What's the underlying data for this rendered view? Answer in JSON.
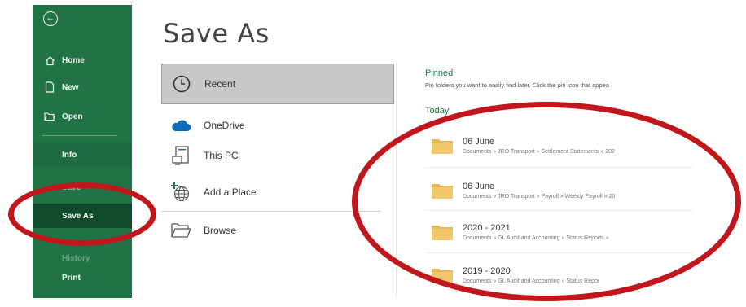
{
  "window": {
    "title": "Save As"
  },
  "sidebar": {
    "items": [
      {
        "label": "Home",
        "icon": "home-icon"
      },
      {
        "label": "New",
        "icon": "new-document-icon"
      },
      {
        "label": "Open",
        "icon": "open-folder-icon"
      },
      {
        "label": "Info"
      },
      {
        "label": "Save"
      },
      {
        "label": "Save As",
        "selected": true
      },
      {
        "label": "History"
      },
      {
        "label": "Print"
      }
    ]
  },
  "locations": [
    {
      "label": "Recent",
      "icon": "clock-icon",
      "selected": true
    },
    {
      "label": "OneDrive",
      "icon": "cloud-icon"
    },
    {
      "label": "This PC",
      "icon": "computer-icon"
    },
    {
      "label": "Add a Place",
      "icon": "globe-add-icon"
    },
    {
      "label": "Browse",
      "icon": "folder-open-icon"
    }
  ],
  "pinned": {
    "heading": "Pinned",
    "description": "Pin folders you want to easily find later. Click the pin icon that appea"
  },
  "today": {
    "heading": "Today",
    "folders": [
      {
        "name": "06 June",
        "path": "Documents » JRO Transport » Settlement Statements » 202"
      },
      {
        "name": "06 June",
        "path": "Documents » JRO Transport » Payroll » Weekly Payroll » 20"
      },
      {
        "name": "2020 - 2021",
        "path": "Documents » GL Audit and Accounting » Status Reports »"
      },
      {
        "name": "2019 - 2020",
        "path": "Documents » GL Audit and Accounting » Status Repor"
      }
    ]
  },
  "colors": {
    "sidebar": "#217346",
    "sidebar_selected": "#0e4a2b",
    "accent_text": "#217346",
    "annotation": "#c2161d",
    "folder": "#e8b95a"
  }
}
